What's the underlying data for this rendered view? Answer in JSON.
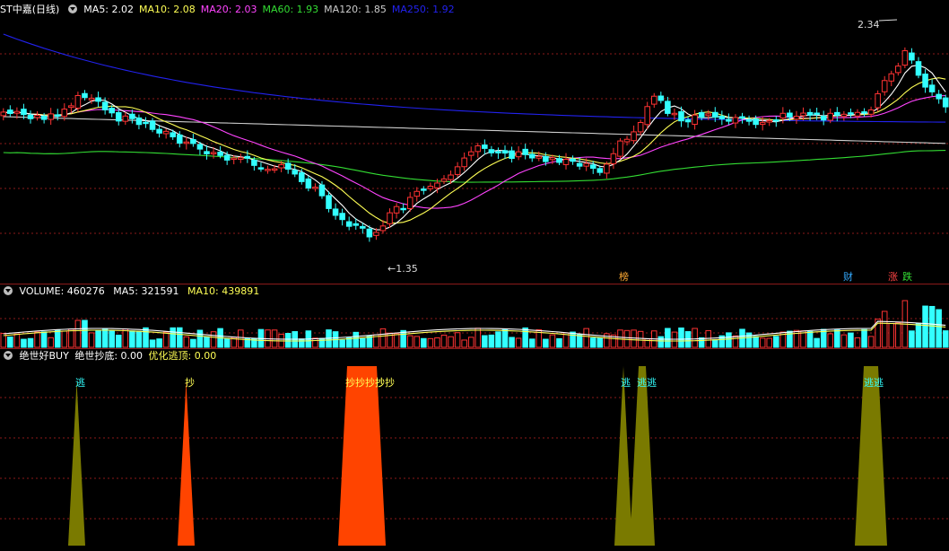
{
  "main_panel": {
    "title": "ST中嘉(日线)",
    "indicators": [
      {
        "label": "MA5: 2.02",
        "color": "#ffffff"
      },
      {
        "label": "MA10: 2.08",
        "color": "#ffff55"
      },
      {
        "label": "MA20: 2.03",
        "color": "#ff44ff"
      },
      {
        "label": "MA60: 1.93",
        "color": "#33dd33"
      },
      {
        "label": "MA120: 1.85",
        "color": "#cccccc"
      },
      {
        "label": "MA250: 1.92",
        "color": "#2222ee"
      }
    ],
    "high_label": "2.34",
    "low_label": "1.35",
    "markers": [
      {
        "text": "榜",
        "color": "#ffaa33"
      },
      {
        "text": "财",
        "color": "#33aaff"
      },
      {
        "text": "涨",
        "color": "#ff4444"
      },
      {
        "text": "跌",
        "color": "#33dd33"
      }
    ]
  },
  "volume_panel": {
    "title": "VOLUME: 460276",
    "ma5": "MA5: 321591",
    "ma10": "MA10: 439891"
  },
  "signal_panel": {
    "title": "绝世好BUY",
    "buy_label": "绝世抄底: 0.00",
    "sell_label": "优化逃顶: 0.00",
    "buy_text": "抄",
    "buy_run_text": "抄抄抄抄抄",
    "sell_text": "逃",
    "sell_pair_text": "逃逃"
  },
  "colors": {
    "up": "#ff3333",
    "down": "#33ffff",
    "buy_fill": "#ff4400",
    "sell_fill": "#7a7a00",
    "grid": "#8b1a1a"
  },
  "chart_data": {
    "type": "candlestick",
    "price_range_visible": [
      1.35,
      2.34
    ],
    "signals": {
      "buy_index": [
        27,
        51,
        52,
        53,
        54,
        55
      ],
      "sell_index": [
        11,
        93,
        96,
        97,
        131,
        132
      ]
    }
  }
}
